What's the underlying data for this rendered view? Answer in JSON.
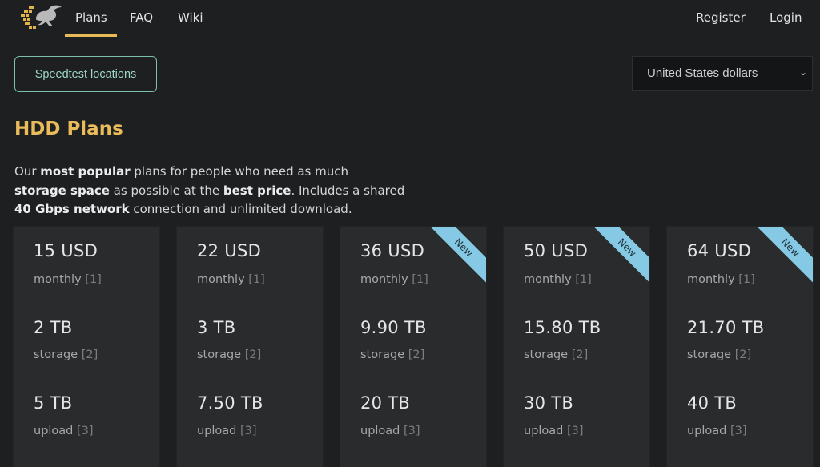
{
  "nav": {
    "logo": "rabbit-logo",
    "links": [
      {
        "label": "Plans",
        "active": true
      },
      {
        "label": "FAQ",
        "active": false
      },
      {
        "label": "Wiki",
        "active": false
      }
    ],
    "register_label": "Register",
    "login_label": "Login"
  },
  "toolbar": {
    "speedtest_label": "Speedtest locations",
    "currency_selected": "United States dollars"
  },
  "section": {
    "title": "HDD Plans",
    "desc_parts": {
      "p1": "Our ",
      "b1": "most popular",
      "p2": " plans for people who need as much ",
      "b2": "storage space",
      "p3": " as possible at the ",
      "b3": "best price",
      "p4": ". Includes a shared ",
      "b4": "40 Gbps network",
      "p5": " connection and unlimited download."
    }
  },
  "plans": [
    {
      "price": "15 USD",
      "price_label": "monthly",
      "price_ref": "[1]",
      "storage": "2 TB",
      "storage_label": "storage",
      "storage_ref": "[2]",
      "upload": "5 TB",
      "upload_label": "upload",
      "upload_ref": "[3]",
      "badge": ""
    },
    {
      "price": "22 USD",
      "price_label": "monthly",
      "price_ref": "[1]",
      "storage": "3 TB",
      "storage_label": "storage",
      "storage_ref": "[2]",
      "upload": "7.50 TB",
      "upload_label": "upload",
      "upload_ref": "[3]",
      "badge": ""
    },
    {
      "price": "36 USD",
      "price_label": "monthly",
      "price_ref": "[1]",
      "storage": "9.90 TB",
      "storage_label": "storage",
      "storage_ref": "[2]",
      "upload": "20 TB",
      "upload_label": "upload",
      "upload_ref": "[3]",
      "badge": "New"
    },
    {
      "price": "50 USD",
      "price_label": "monthly",
      "price_ref": "[1]",
      "storage": "15.80 TB",
      "storage_label": "storage",
      "storage_ref": "[2]",
      "upload": "30 TB",
      "upload_label": "upload",
      "upload_ref": "[3]",
      "badge": "New"
    },
    {
      "price": "64 USD",
      "price_label": "monthly",
      "price_ref": "[1]",
      "storage": "21.70 TB",
      "storage_label": "storage",
      "storage_ref": "[2]",
      "upload": "40 TB",
      "upload_label": "upload",
      "upload_ref": "[3]",
      "badge": "New"
    }
  ],
  "colors": {
    "accent": "#e9bb5b",
    "ribbon": "#86c9e4",
    "speedtest_border": "#7fbfb0"
  }
}
